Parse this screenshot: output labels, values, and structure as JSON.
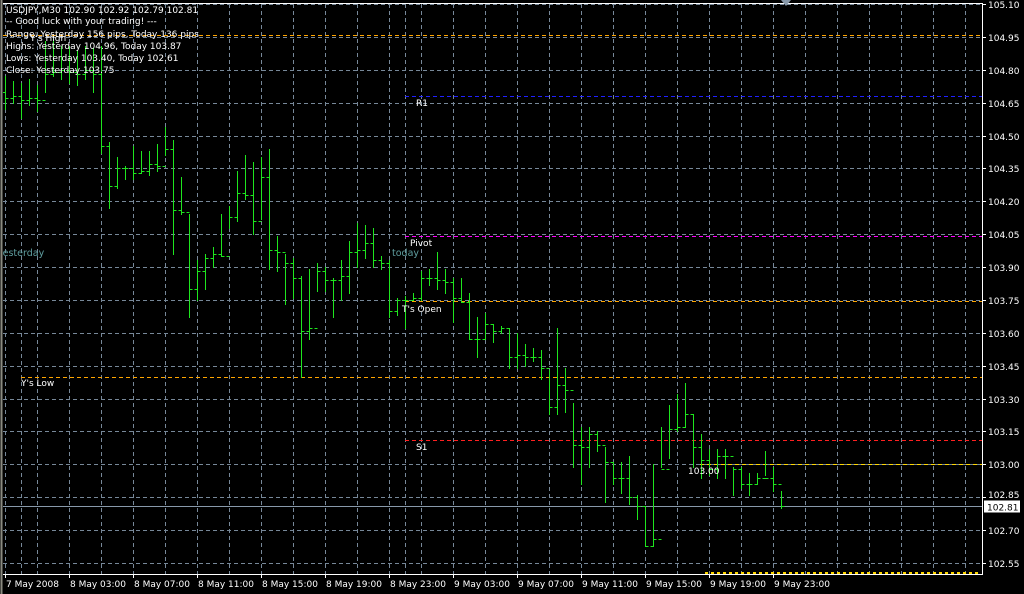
{
  "info": {
    "header": "USDJPY,M30  102.90 102.92 102.79 102.81",
    "greeting": "-- Good luck with your trading! ---",
    "range": "Range: Yesterday 156 pips, Today 136 pips",
    "highs": "Highs: Yesterday 104.96, Today 103.87",
    "lows": "Lows:  Yesterday 103.40, Today 102.61",
    "close": "Close: Yesterday 103.75"
  },
  "day_labels": {
    "yesterday": "yesterday",
    "today": "today"
  },
  "current_price": "102.81",
  "colors": {
    "bars": "#1ee61e",
    "grid": "#778899",
    "background": "#000000",
    "axis": "#ffffff"
  },
  "levels": [
    {
      "id": "yhigh",
      "label": "Y's High",
      "price": 104.96,
      "color": "#ffa500",
      "scope": "yesterday"
    },
    {
      "id": "r1",
      "label": "R1",
      "price": 104.68,
      "color": "#2020ff",
      "scope": "today"
    },
    {
      "id": "pivot",
      "label": "Pivot",
      "price": 104.04,
      "color": "#ff00ff",
      "scope": "today"
    },
    {
      "id": "topen",
      "label": "T's Open",
      "price": 103.745,
      "color": "#ffa500",
      "scope": "today"
    },
    {
      "id": "ylow",
      "label": "Y's Low",
      "price": 103.4,
      "color": "#ffa500",
      "scope": "yesterday"
    },
    {
      "id": "s1",
      "label": "S1",
      "price": 103.11,
      "color": "#ff2020",
      "scope": "today"
    },
    {
      "id": "round",
      "label": "103.00",
      "price": 103.0,
      "color": "#ffd700",
      "scope": "recent"
    }
  ],
  "chart_data": {
    "type": "ohlc",
    "symbol": "USDJPY",
    "timeframe": "M30",
    "first_bar_time": "7 May 2008 23:00",
    "first_open": 104.7,
    "ylim": [
      102.5,
      105.1
    ],
    "yticks": [
      "105.10",
      "104.95",
      "104.80",
      "104.65",
      "104.50",
      "104.35",
      "104.20",
      "104.05",
      "103.90",
      "103.75",
      "103.60",
      "103.45",
      "103.30",
      "103.15",
      "103.00",
      "102.85",
      "102.70",
      "102.55"
    ],
    "xticks": [
      "7 May 2008",
      "8 May 03:00",
      "8 May 07:00",
      "8 May 11:00",
      "8 May 15:00",
      "8 May 19:00",
      "8 May 23:00",
      "9 May 03:00",
      "9 May 07:00",
      "9 May 11:00",
      "9 May 15:00",
      "9 May 19:00",
      "9 May 23:00"
    ],
    "high": [
      104.77,
      104.75,
      104.74,
      104.76,
      104.73,
      104.93,
      104.94,
      104.91,
      104.91,
      104.89,
      104.91,
      104.9,
      104.91,
      104.47,
      104.4,
      104.36,
      104.45,
      104.43,
      104.43,
      104.46,
      104.54,
      104.48,
      104.31,
      104.14,
      103.93,
      103.96,
      103.99,
      104.14,
      104.18,
      104.34,
      104.41,
      104.38,
      104.4,
      104.44,
      104.04,
      103.96,
      103.94,
      103.86,
      103.89,
      103.92,
      103.9,
      103.85,
      103.93,
      104.02,
      104.1,
      104.09,
      104.08,
      103.95,
      103.93,
      103.76,
      103.77,
      103.78,
      103.88,
      103.89,
      103.97,
      103.89,
      103.85,
      103.85,
      103.78,
      103.67,
      103.69,
      103.64,
      103.63,
      103.62,
      103.6,
      103.55,
      103.53,
      103.52,
      103.43,
      103.62,
      103.44,
      103.28,
      103.17,
      103.17,
      103.15,
      103.08,
      103.01,
      103.01,
      103.04,
      102.86,
      102.81,
      103.0,
      103.17,
      103.27,
      103.32,
      103.37,
      103.23,
      103.14,
      103.07,
      103.07,
      103.07,
      102.99,
      102.99,
      102.96,
      102.96,
      103.06,
      102.99,
      102.88
    ],
    "low": [
      104.62,
      104.65,
      104.58,
      104.64,
      104.61,
      104.7,
      104.77,
      104.76,
      104.74,
      104.73,
      104.76,
      104.7,
      104.42,
      104.17,
      104.26,
      104.3,
      104.3,
      104.33,
      104.32,
      104.34,
      104.41,
      103.96,
      104.14,
      103.67,
      103.75,
      103.8,
      103.9,
      103.95,
      104.08,
      104.11,
      104.21,
      104.05,
      104.12,
      103.89,
      103.88,
      103.73,
      103.76,
      103.4,
      103.57,
      103.79,
      103.79,
      103.67,
      103.75,
      103.78,
      103.9,
      103.94,
      103.9,
      103.89,
      103.67,
      103.68,
      103.62,
      103.75,
      103.75,
      103.82,
      103.8,
      103.78,
      103.65,
      103.74,
      103.57,
      103.49,
      103.57,
      103.56,
      103.6,
      103.44,
      103.44,
      103.45,
      103.47,
      103.39,
      103.23,
      103.23,
      103.24,
      102.99,
      102.91,
      102.99,
      103.06,
      102.83,
      102.91,
      102.87,
      102.82,
      102.75,
      102.63,
      102.63,
      102.99,
      103.03,
      103.15,
      103.17,
      102.99,
      102.94,
      102.95,
      102.94,
      102.94,
      102.86,
      102.89,
      102.86,
      102.91,
      102.95,
      102.88,
      102.8
    ],
    "close": [
      104.67,
      104.68,
      104.66,
      104.67,
      104.66,
      104.78,
      104.79,
      104.8,
      104.79,
      104.78,
      104.8,
      104.78,
      104.45,
      104.27,
      104.35,
      104.35,
      104.33,
      104.34,
      104.37,
      104.36,
      104.44,
      104.16,
      104.15,
      103.8,
      103.88,
      103.94,
      103.96,
      103.95,
      104.13,
      104.24,
      104.23,
      104.11,
      104.31,
      103.98,
      103.97,
      103.92,
      103.85,
      103.61,
      103.62,
      103.88,
      103.84,
      103.84,
      103.86,
      103.97,
      103.98,
      104.01,
      103.93,
      103.92,
      103.7,
      103.75,
      103.75,
      103.76,
      103.85,
      103.85,
      103.84,
      103.83,
      103.76,
      103.74,
      103.57,
      103.57,
      103.64,
      103.61,
      103.62,
      103.49,
      103.5,
      103.49,
      103.49,
      103.44,
      103.26,
      103.36,
      103.34,
      103.09,
      103.08,
      103.14,
      103.09,
      103.01,
      102.94,
      102.94,
      102.85,
      102.81,
      102.63,
      102.66,
      102.98,
      103.16,
      103.17,
      103.23,
      103.08,
      103.02,
      102.98,
      103.04,
      103.04,
      102.98,
      102.91,
      102.91,
      102.94,
      102.94,
      102.91,
      102.81
    ]
  }
}
